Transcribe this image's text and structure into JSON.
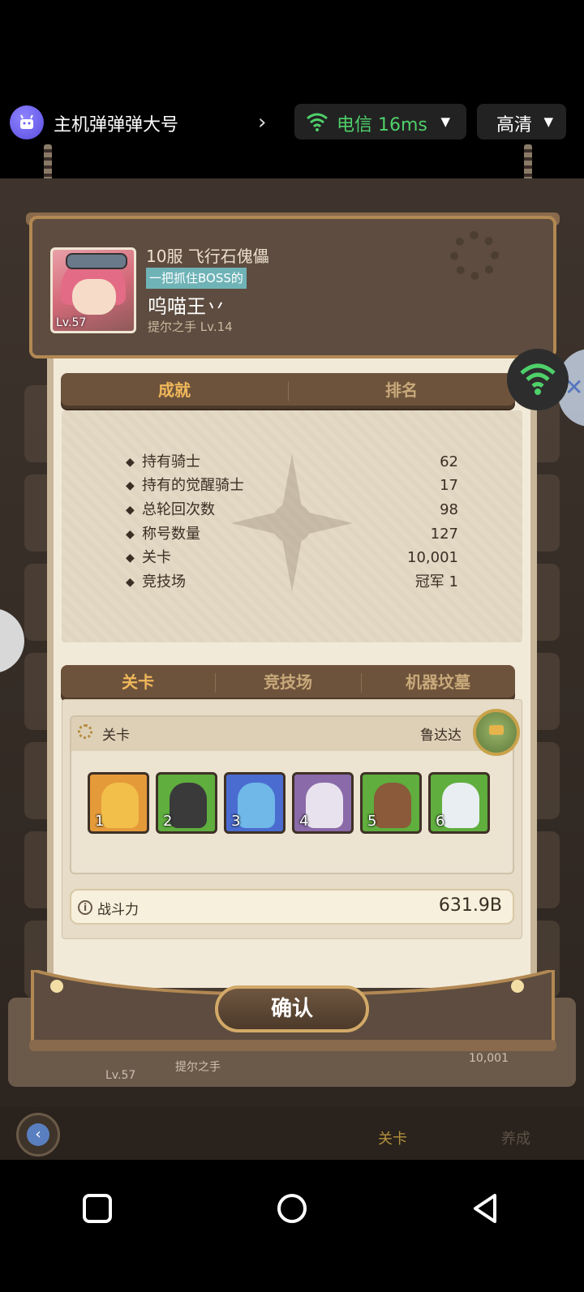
{
  "stream_bar": {
    "app_name": "主机弹弹弹大号",
    "network": "电信 16ms",
    "quality": "高清"
  },
  "profile": {
    "server": "10服 飞行石傀儡",
    "title_badge": "一把抓住BOSS的",
    "player_name": "呜喵王丷",
    "guild": "提尔之手 Lv.14",
    "avatar_level": "Lv.57"
  },
  "tabs_top": [
    {
      "label": "成就",
      "active": true
    },
    {
      "label": "排名",
      "active": false
    }
  ],
  "stats": [
    {
      "label": "持有骑士",
      "value": "62"
    },
    {
      "label": "持有的觉醒骑士",
      "value": "17"
    },
    {
      "label": "总轮回次数",
      "value": "98"
    },
    {
      "label": "称号数量",
      "value": "127"
    },
    {
      "label": "关卡",
      "value": "10,001"
    },
    {
      "label": "竞技场",
      "value": "冠军 1"
    }
  ],
  "tabs_mode": [
    {
      "label": "关卡",
      "active": true
    },
    {
      "label": "竞技场",
      "active": false
    },
    {
      "label": "机器坟墓",
      "active": false
    }
  ],
  "stage": {
    "label": "关卡",
    "boss_name": "鲁达达"
  },
  "team": [
    {
      "slot": "1",
      "bg": "#e59a3a",
      "char": "#f2c04a"
    },
    {
      "slot": "2",
      "bg": "#5fae3e",
      "char": "#3a3a3a"
    },
    {
      "slot": "3",
      "bg": "#4a6cd0",
      "char": "#6fb8e8"
    },
    {
      "slot": "4",
      "bg": "#8a6aa8",
      "char": "#e8e2ee"
    },
    {
      "slot": "5",
      "bg": "#5fae3e",
      "char": "#8a5a3a"
    },
    {
      "slot": "6",
      "bg": "#5fae3e",
      "char": "#e8eef2"
    }
  ],
  "power": {
    "label": "战斗力",
    "value": "631.9B"
  },
  "confirm_label": "确认",
  "background": {
    "lv": "Lv.57",
    "guild": "提尔之手",
    "value": "10,001",
    "nav_tab1": "关卡",
    "nav_tab2": "养成"
  },
  "colors": {
    "accent_gold": "#f0b85a",
    "panel": "#f2ead9",
    "frame": "#5d4c3f"
  }
}
